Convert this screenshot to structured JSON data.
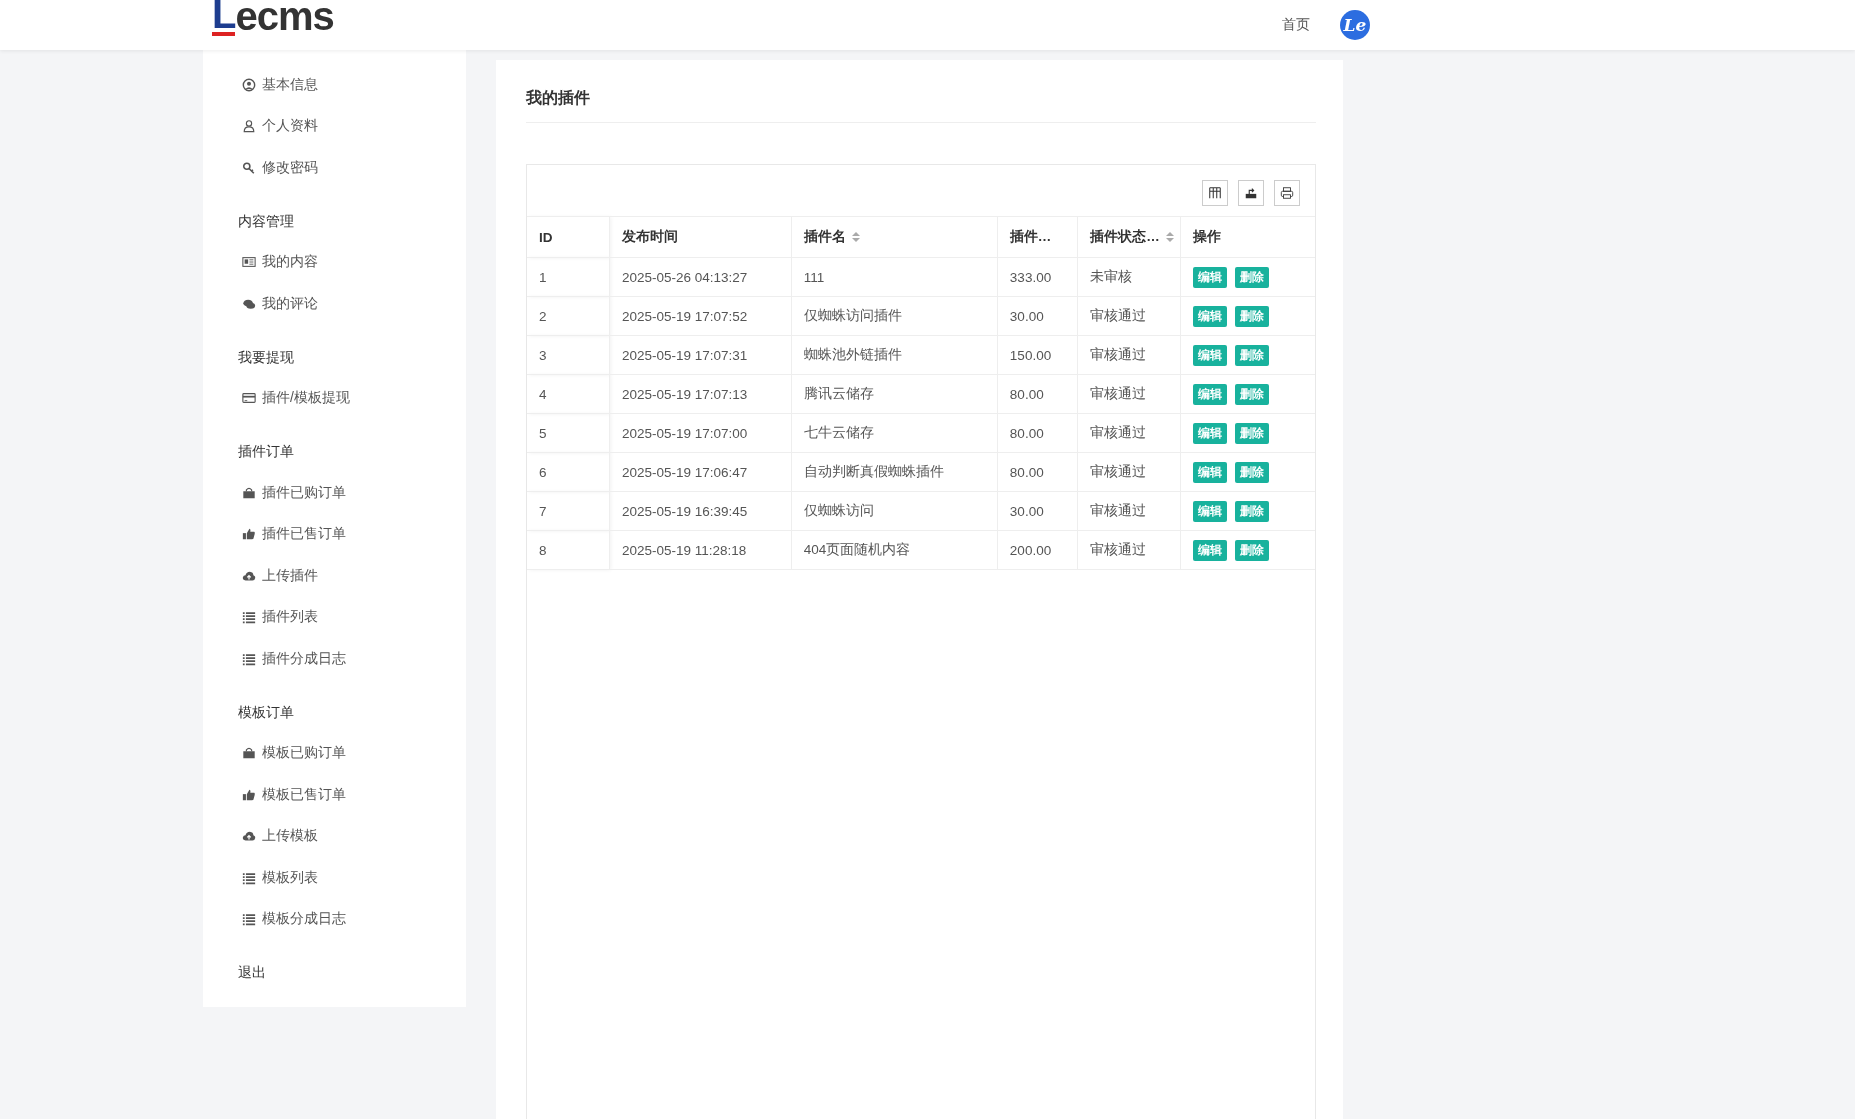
{
  "header": {
    "logo": {
      "mark": "L",
      "text": "ecms"
    },
    "nav": [
      {
        "label": "首页"
      }
    ],
    "avatar": "Le"
  },
  "sidebar": {
    "sections": [
      {
        "items": [
          {
            "label": "基本信息"
          },
          {
            "label": "个人资料"
          },
          {
            "label": "修改密码"
          }
        ]
      },
      {
        "heading": "内容管理",
        "items": [
          {
            "label": "我的内容"
          },
          {
            "label": "我的评论"
          }
        ]
      },
      {
        "heading": "我要提现",
        "items": [
          {
            "label": "插件/模板提现"
          }
        ]
      },
      {
        "heading": "插件订单",
        "items": [
          {
            "label": "插件已购订单"
          },
          {
            "label": "插件已售订单"
          },
          {
            "label": "上传插件"
          },
          {
            "label": "插件列表"
          },
          {
            "label": "插件分成日志"
          }
        ]
      },
      {
        "heading": "模板订单",
        "items": [
          {
            "label": "模板已购订单"
          },
          {
            "label": "模板已售订单"
          },
          {
            "label": "上传模板"
          },
          {
            "label": "模板列表"
          },
          {
            "label": "模板分成日志"
          }
        ]
      },
      {
        "heading": "退出"
      }
    ]
  },
  "main": {
    "title": "我的插件",
    "table": {
      "columns": [
        {
          "label": "ID",
          "sortable": false
        },
        {
          "label": "发布时间",
          "sortable": false
        },
        {
          "label": "插件名",
          "sortable": true
        },
        {
          "label": "插件…",
          "sortable": false
        },
        {
          "label": "插件状态…",
          "sortable": true
        },
        {
          "label": "操作",
          "sortable": false
        }
      ],
      "rows": [
        {
          "cells": [
            "1",
            "2025-05-26 04:13:27",
            "111",
            "333.00",
            "未审核"
          ],
          "actions": [
            "编辑",
            "删除"
          ]
        },
        {
          "cells": [
            "2",
            "2025-05-19 17:07:52",
            "仅蜘蛛访问插件",
            "30.00",
            "审核通过"
          ],
          "actions": [
            "编辑",
            "删除"
          ]
        },
        {
          "cells": [
            "3",
            "2025-05-19 17:07:31",
            "蜘蛛池外链插件",
            "150.00",
            "审核通过"
          ],
          "actions": [
            "编辑",
            "删除"
          ]
        },
        {
          "cells": [
            "4",
            "2025-05-19 17:07:13",
            "腾讯云储存",
            "80.00",
            "审核通过"
          ],
          "actions": [
            "编辑",
            "删除"
          ]
        },
        {
          "cells": [
            "5",
            "2025-05-19 17:07:00",
            "七牛云储存",
            "80.00",
            "审核通过"
          ],
          "actions": [
            "编辑",
            "删除"
          ]
        },
        {
          "cells": [
            "6",
            "2025-05-19 17:06:47",
            "自动判断真假蜘蛛插件",
            "80.00",
            "审核通过"
          ],
          "actions": [
            "编辑",
            "删除"
          ]
        },
        {
          "cells": [
            "7",
            "2025-05-19 16:39:45",
            "仅蜘蛛访问",
            "30.00",
            "审核通过"
          ],
          "actions": [
            "编辑",
            "删除"
          ]
        },
        {
          "cells": [
            "8",
            "2025-05-19 11:28:18",
            "404页面随机内容",
            "200.00",
            "审核通过"
          ],
          "actions": [
            "编辑",
            "删除"
          ]
        }
      ]
    }
  }
}
